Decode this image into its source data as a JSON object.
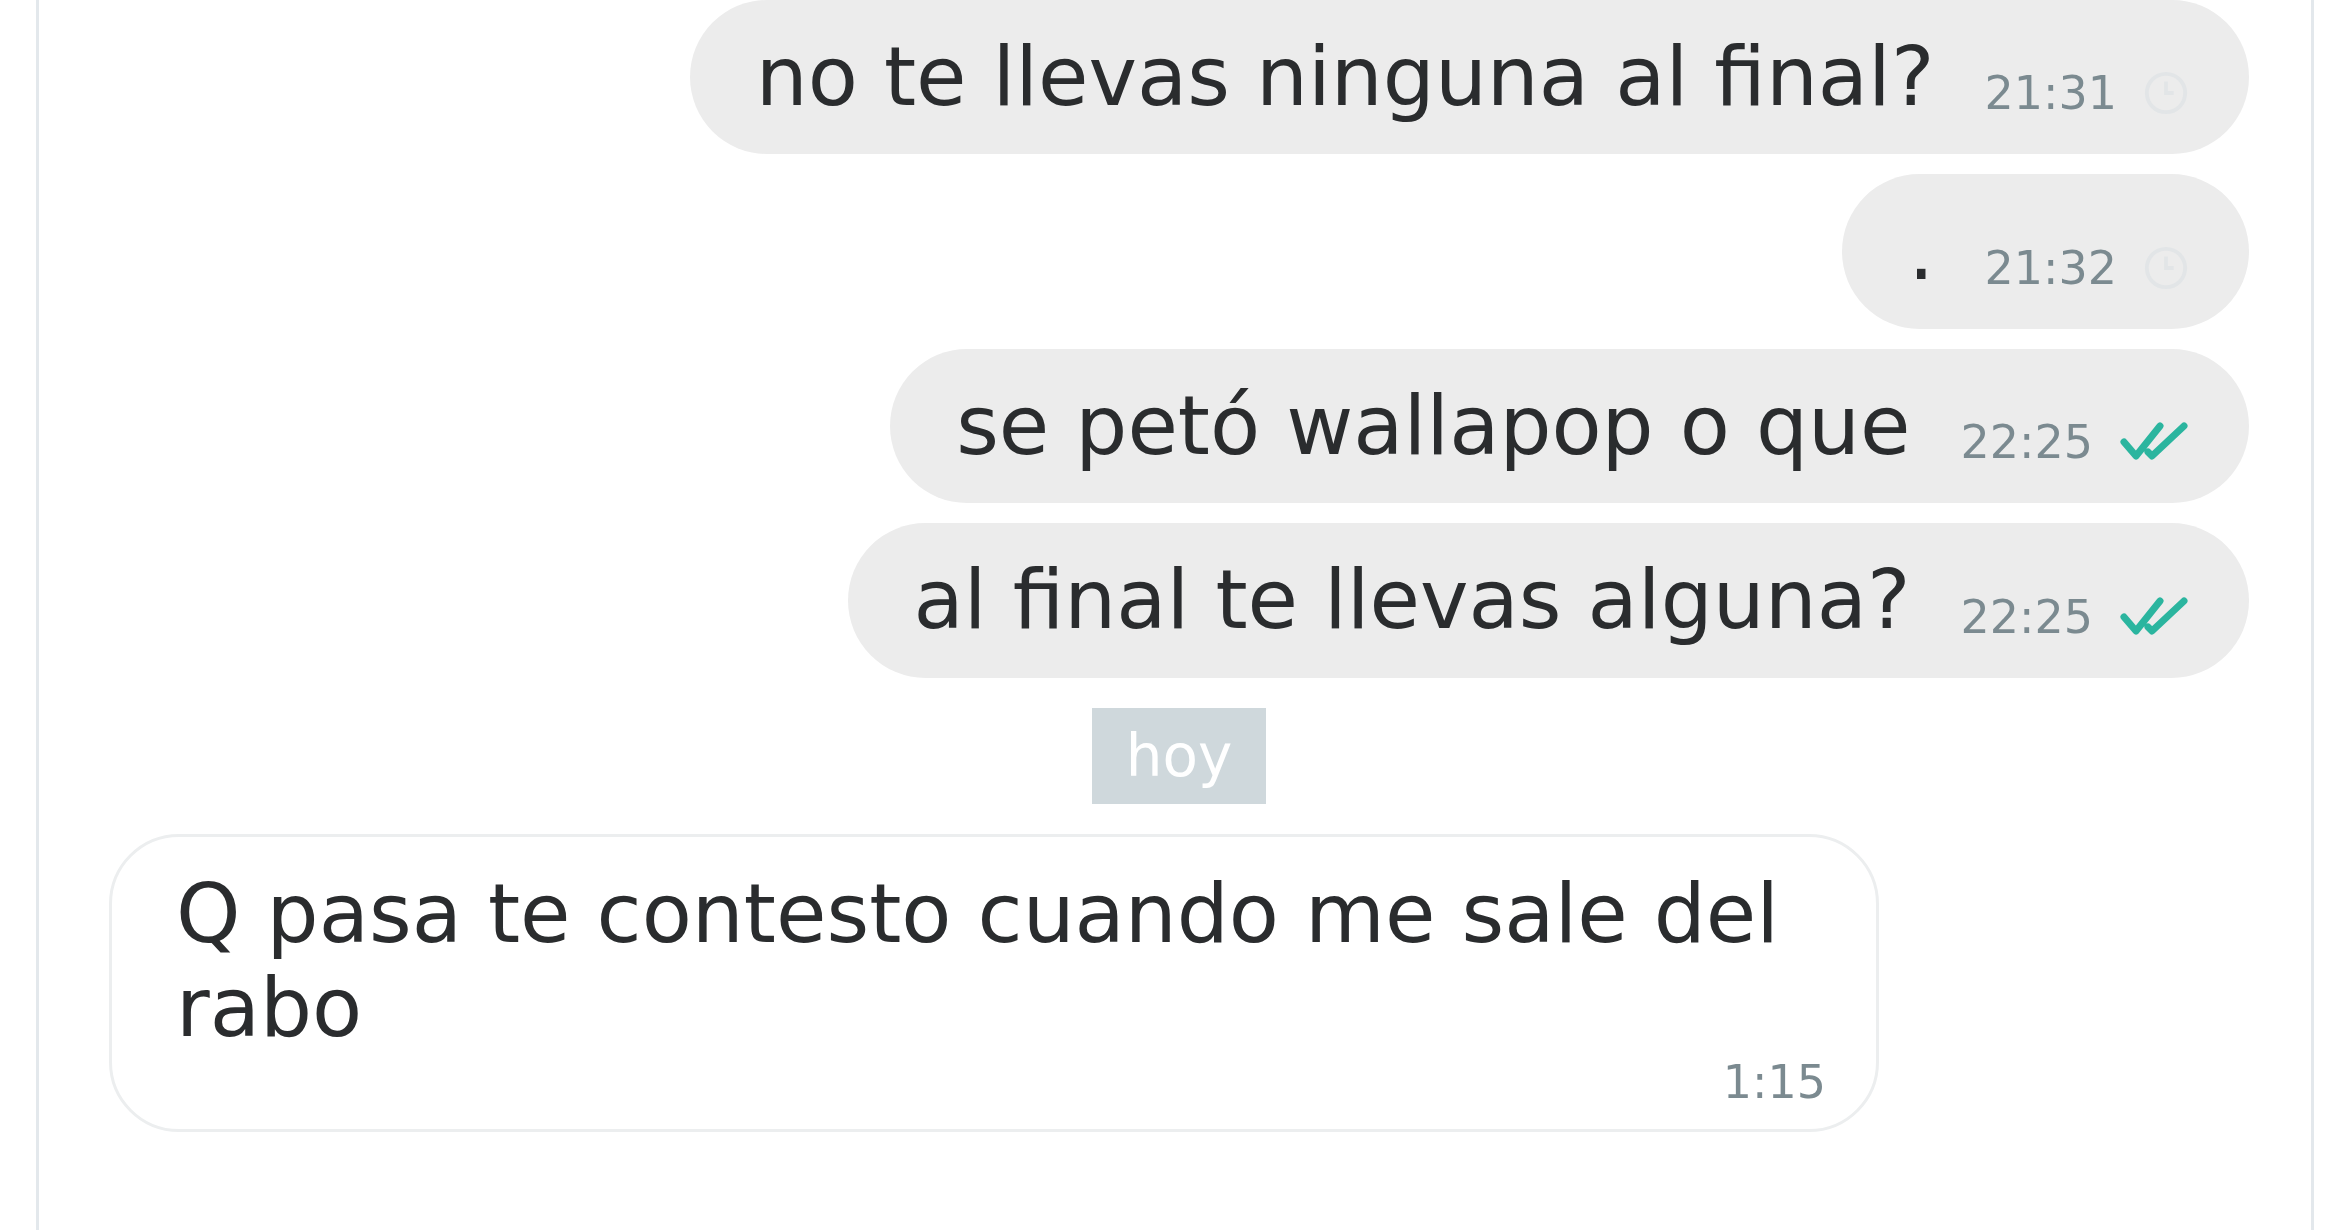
{
  "messages": [
    {
      "kind": "outgoing",
      "text": "no te llevas ninguna al final?",
      "time": "21:31",
      "read": false
    },
    {
      "kind": "outgoing",
      "text": ".",
      "time": "21:32",
      "read": false
    },
    {
      "kind": "outgoing",
      "text": "se petó wallapop o que",
      "time": "22:25",
      "read": true
    },
    {
      "kind": "outgoing",
      "text": "al final te llevas alguna?",
      "time": "22:25",
      "read": true
    },
    {
      "kind": "date",
      "text": "hoy"
    },
    {
      "kind": "incoming",
      "text": "Q pasa te contesto cuando me sale del rabo",
      "time": "1:15"
    }
  ]
}
